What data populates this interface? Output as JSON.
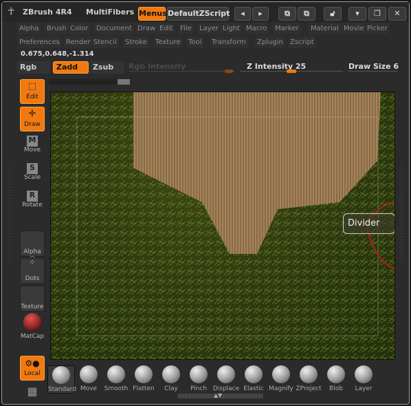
{
  "title": {
    "app": "ZBrush 4R4",
    "doc": "MultiFibers",
    "menus": "Menus",
    "script": "DefaultZScript"
  },
  "menu_row1": [
    "Alpha",
    "Brush",
    "Color",
    "Document",
    "Draw",
    "Edit",
    "File",
    "Layer",
    "Light",
    "Macro",
    "Marker",
    "Material",
    "Movie",
    "Picker"
  ],
  "menu_row2": [
    "Preferences",
    "Render",
    "Stencil",
    "Stroke",
    "Texture",
    "Tool",
    "Transform",
    "Zplugin",
    "Zscript"
  ],
  "coords": "0.675,0.648,-1.314",
  "controls": {
    "rgb": "Rgb",
    "zadd": "Zadd",
    "zsub": "Zsub",
    "rgb_intensity": "Rgb Intensity",
    "z_intensity": "Z Intensity 25",
    "draw_size": "Draw Size 6",
    "z_intensity_value": 25,
    "draw_size_value": 6
  },
  "left_tools": {
    "edit": "Edit",
    "draw": "Draw",
    "move": "Move",
    "scale": "Scale",
    "rotate": "Rotate",
    "alpha": "Alpha",
    "dots": "Dots",
    "texture": "Texture",
    "matcap": "MatCap",
    "local": "Local"
  },
  "tooltip": "Divider",
  "brushes": [
    "Standard",
    "Move",
    "Smooth",
    "Flatten",
    "Clay",
    "Pinch",
    "Displace",
    "Elastic",
    "Magnify",
    "ZProject",
    "Blob",
    "Layer"
  ],
  "colors": {
    "accent": "#f07a10"
  }
}
